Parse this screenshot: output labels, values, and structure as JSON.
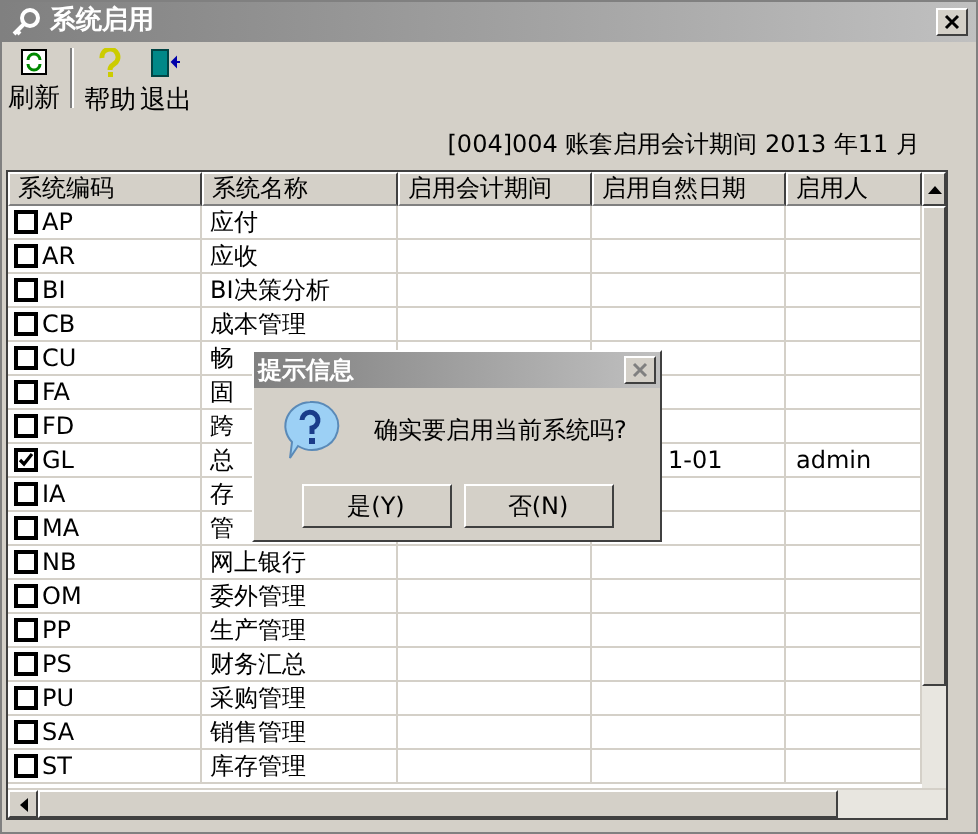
{
  "window": {
    "title": "系统启用"
  },
  "toolbar": [
    {
      "kind": "refresh",
      "label": "刷新"
    },
    {
      "kind": "help",
      "label": "帮助"
    },
    {
      "kind": "exit",
      "label": "退出"
    }
  ],
  "info": "[004]004 账套启用会计期间 2013 年11 月",
  "table": {
    "columns": [
      "系统编码",
      "系统名称",
      "启用会计期间",
      "启用自然日期",
      "启用人"
    ],
    "rows": [
      {
        "code": "AP",
        "name": "应付",
        "checked": false
      },
      {
        "code": "AR",
        "name": "应收",
        "checked": false
      },
      {
        "code": "BI",
        "name": "BI决策分析",
        "checked": false
      },
      {
        "code": "CB",
        "name": "成本管理",
        "checked": false
      },
      {
        "code": "CU",
        "name": "畅",
        "checked": false
      },
      {
        "code": "FA",
        "name": "固",
        "checked": false
      },
      {
        "code": "FD",
        "name": "跨",
        "checked": false
      },
      {
        "code": "GL",
        "name": "总",
        "checked": true,
        "date": "1-01",
        "user": "admin"
      },
      {
        "code": "IA",
        "name": "存",
        "checked": false
      },
      {
        "code": "MA",
        "name": "管",
        "checked": false
      },
      {
        "code": "NB",
        "name": "网上银行",
        "checked": false
      },
      {
        "code": "OM",
        "name": "委外管理",
        "checked": false
      },
      {
        "code": "PP",
        "name": "生产管理",
        "checked": false
      },
      {
        "code": "PS",
        "name": "财务汇总",
        "checked": false
      },
      {
        "code": "PU",
        "name": "采购管理",
        "checked": false
      },
      {
        "code": "SA",
        "name": "销售管理",
        "checked": false
      },
      {
        "code": "ST",
        "name": "库存管理",
        "checked": false
      }
    ]
  },
  "dialog": {
    "title": "提示信息",
    "message": "确实要启用当前系统吗?",
    "buttons": [
      "是(Y)",
      "否(N)"
    ]
  }
}
